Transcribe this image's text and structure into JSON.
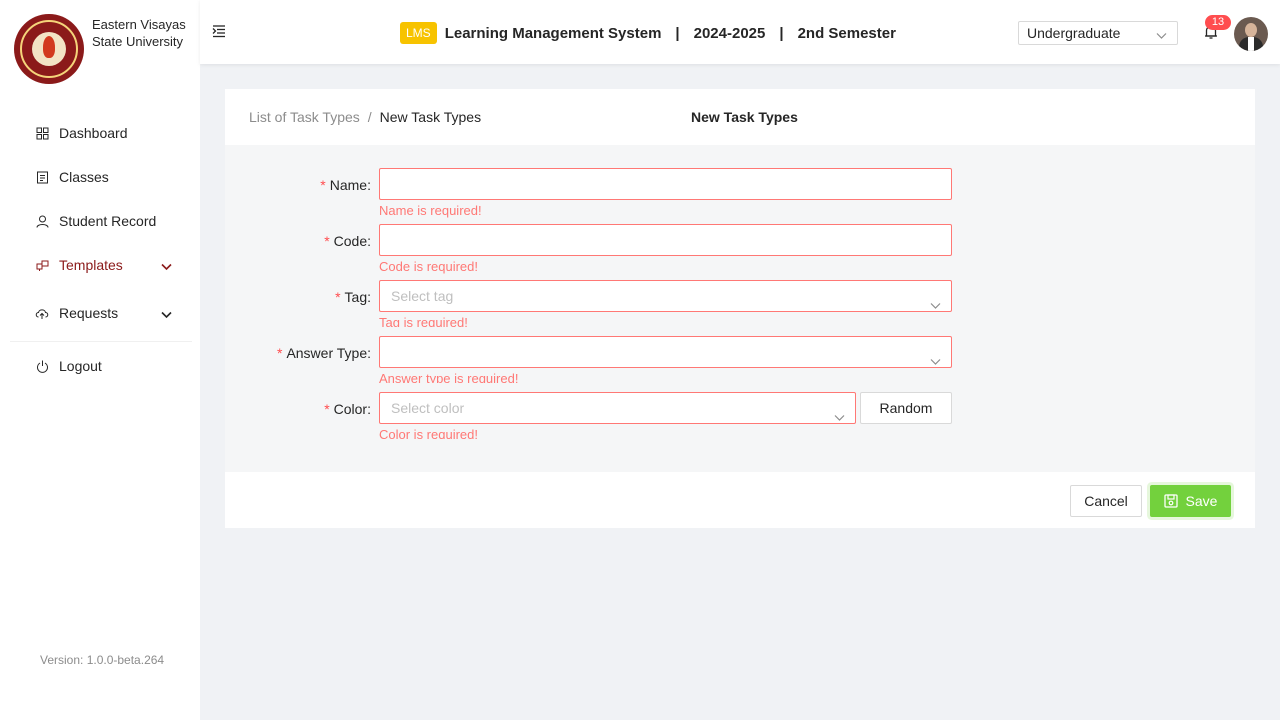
{
  "brand": {
    "name_line1": "Eastern Visayas",
    "name_line2": "State University"
  },
  "sidebar": {
    "items": [
      {
        "label": "Dashboard",
        "icon": "dashboard-icon"
      },
      {
        "label": "Classes",
        "icon": "classes-icon"
      },
      {
        "label": "Student Record",
        "icon": "user-icon"
      },
      {
        "label": "Templates",
        "icon": "templates-icon",
        "active": true,
        "has_submenu": true
      },
      {
        "label": "Requests",
        "icon": "upload-cloud-icon",
        "has_submenu": true
      }
    ],
    "logout_label": "Logout",
    "version": "Version: 1.0.0-beta.264"
  },
  "header": {
    "badge": "LMS",
    "system_name": "Learning Management System",
    "separator": "|",
    "school_year": "2024-2025",
    "semester": "2nd Semester",
    "level_selected": "Undergraduate",
    "notification_count": "13"
  },
  "page": {
    "breadcrumb_parent": "List of Task Types",
    "breadcrumb_separator": "/",
    "breadcrumb_current": "New Task Types",
    "title": "New Task Types"
  },
  "form": {
    "required_mark": "*",
    "name": {
      "label": "Name",
      "value": "",
      "error": "Name is required!"
    },
    "code": {
      "label": "Code",
      "value": "",
      "error": "Code is required!"
    },
    "tag": {
      "label": "Tag",
      "placeholder": "Select tag",
      "error": "Tag is required!"
    },
    "answer_type": {
      "label": "Answer Type",
      "placeholder": "",
      "error": "Answer type is required!"
    },
    "color": {
      "label": "Color",
      "placeholder": "Select color",
      "error": "Color is required!",
      "random_label": "Random"
    }
  },
  "actions": {
    "cancel_label": "Cancel",
    "save_label": "Save"
  },
  "colors": {
    "accent": "#8b1a1a",
    "save": "#73d13d",
    "error": "#ff4d4f",
    "badge": "#f7c300"
  }
}
